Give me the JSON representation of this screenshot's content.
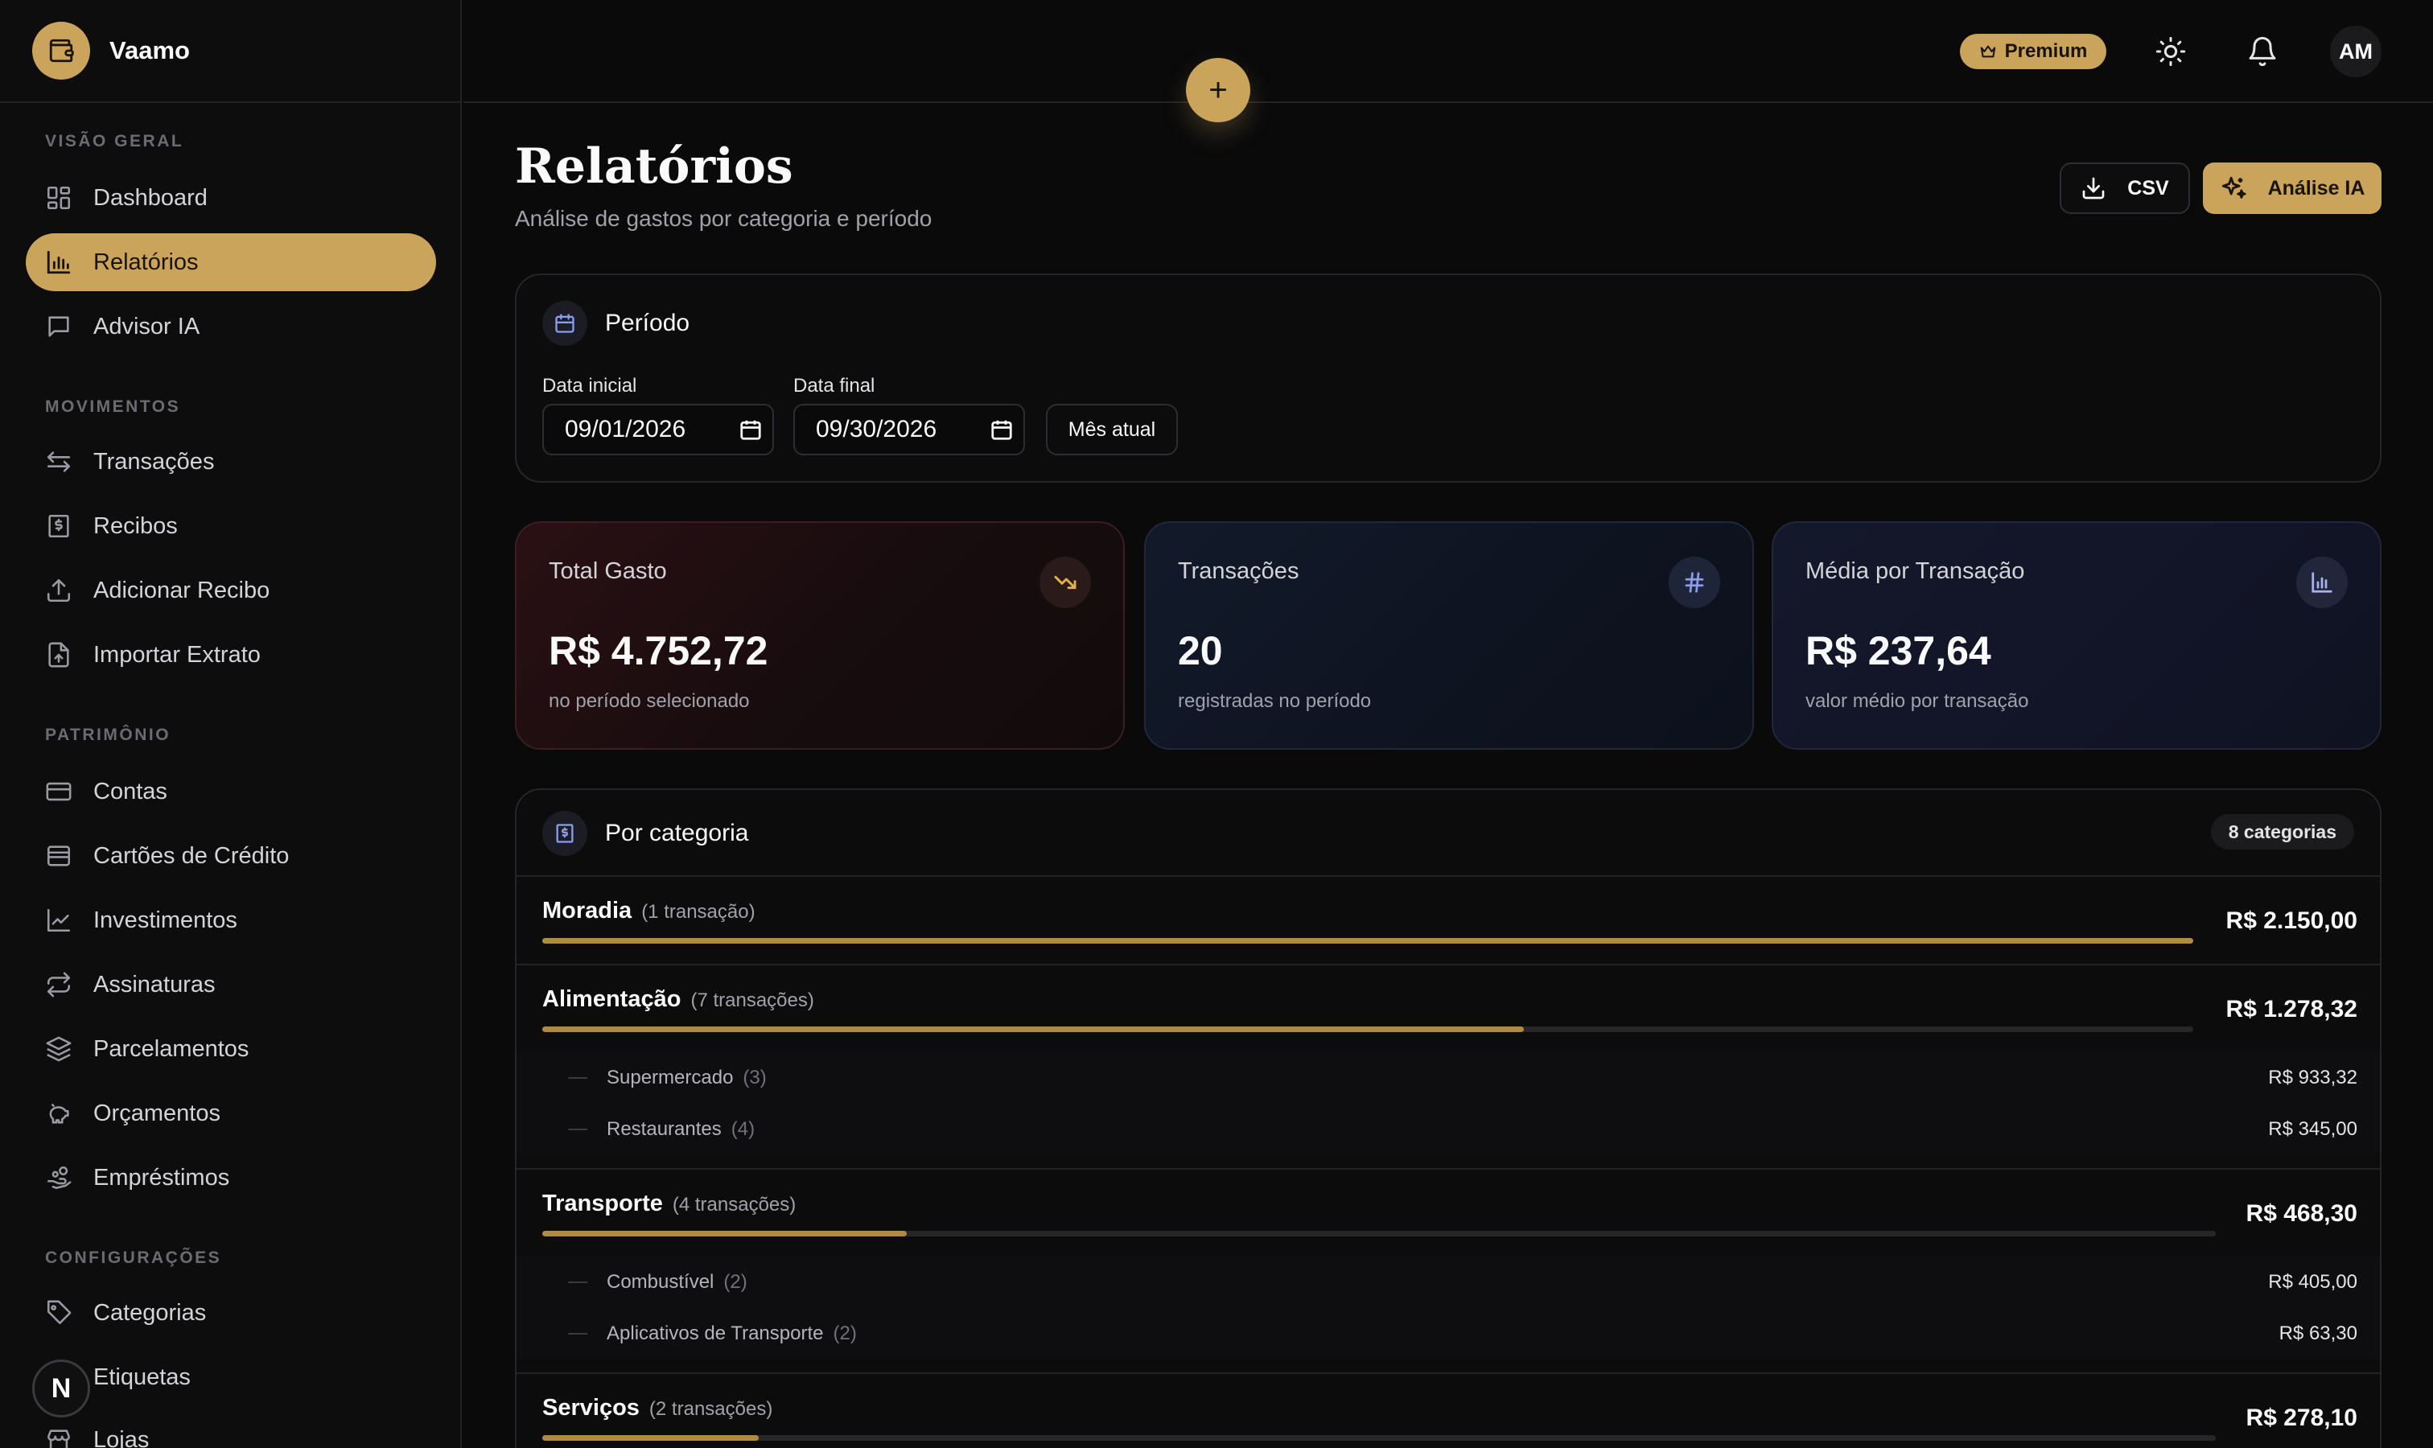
{
  "app": {
    "name": "Vaamo"
  },
  "sidebar": {
    "sections": [
      {
        "title": "VISÃO GERAL",
        "items": [
          {
            "label": "Dashboard",
            "icon": "dashboard-icon"
          },
          {
            "label": "Relatórios",
            "icon": "bar-chart-icon",
            "active": true
          },
          {
            "label": "Advisor IA",
            "icon": "chat-icon"
          }
        ]
      },
      {
        "title": "MOVIMENTOS",
        "items": [
          {
            "label": "Transações",
            "icon": "arrows-swap-icon"
          },
          {
            "label": "Recibos",
            "icon": "receipt-icon"
          },
          {
            "label": "Adicionar Recibo",
            "icon": "upload-icon"
          },
          {
            "label": "Importar Extrato",
            "icon": "file-import-icon"
          }
        ]
      },
      {
        "title": "PATRIMÔNIO",
        "items": [
          {
            "label": "Contas",
            "icon": "wallet-card-icon"
          },
          {
            "label": "Cartões de Crédito",
            "icon": "credit-card-icon"
          },
          {
            "label": "Investimentos",
            "icon": "line-chart-icon"
          },
          {
            "label": "Assinaturas",
            "icon": "repeat-icon"
          },
          {
            "label": "Parcelamentos",
            "icon": "layers-icon"
          },
          {
            "label": "Orçamentos",
            "icon": "piggy-bank-icon"
          },
          {
            "label": "Empréstimos",
            "icon": "hand-coins-icon"
          }
        ]
      },
      {
        "title": "CONFIGURAÇÕES",
        "items": [
          {
            "label": "Categorias",
            "icon": "tag-icon"
          },
          {
            "label": "Etiquetas",
            "icon": "tags-icon"
          },
          {
            "label": "Lojas",
            "icon": "store-icon"
          }
        ]
      }
    ],
    "badge": "N"
  },
  "topbar": {
    "premium_label": "Premium",
    "avatar_initials": "AM",
    "fab_label": "+"
  },
  "header": {
    "title": "Relatórios",
    "subtitle": "Análise de gastos por categoria e período",
    "csv_label": "CSV",
    "ai_label": "Análise IA"
  },
  "period": {
    "title": "Período",
    "start_label": "Data inicial",
    "start_value": "09/01/2026",
    "end_label": "Data final",
    "end_value": "09/30/2026",
    "current_month_label": "Mês atual"
  },
  "stats": [
    {
      "label": "Total Gasto",
      "value": "R$ 4.752,72",
      "desc": "no período selecionado",
      "icon": "trending-down-icon"
    },
    {
      "label": "Transações",
      "value": "20",
      "desc": "registradas no período",
      "icon": "hash-icon"
    },
    {
      "label": "Média por Transação",
      "value": "R$ 237,64",
      "desc": "valor médio por transação",
      "icon": "bar-chart-icon"
    }
  ],
  "categories": {
    "title": "Por categoria",
    "count_label": "8 categorias",
    "items": [
      {
        "name": "Moradia",
        "count": "(1 transação)",
        "amount": "R$ 2.150,00",
        "share": 1.0,
        "subs": []
      },
      {
        "name": "Alimentação",
        "count": "(7 transações)",
        "amount": "R$ 1.278,32",
        "share": 0.5946,
        "subs": [
          {
            "name": "Supermercado",
            "count": "(3)",
            "amount": "R$ 933,32"
          },
          {
            "name": "Restaurantes",
            "count": "(4)",
            "amount": "R$ 345,00"
          }
        ]
      },
      {
        "name": "Transporte",
        "count": "(4 transações)",
        "amount": "R$ 468,30",
        "share": 0.2178,
        "subs": [
          {
            "name": "Combustível",
            "count": "(2)",
            "amount": "R$ 405,00"
          },
          {
            "name": "Aplicativos de Transporte",
            "count": "(2)",
            "amount": "R$ 63,30"
          }
        ]
      },
      {
        "name": "Serviços",
        "count": "(2 transações)",
        "amount": "R$ 278,10",
        "share": 0.1293,
        "subs": []
      }
    ]
  },
  "colors": {
    "accent": "#c9a45a",
    "bar": "#b08a43",
    "background": "#0a0a0b"
  }
}
